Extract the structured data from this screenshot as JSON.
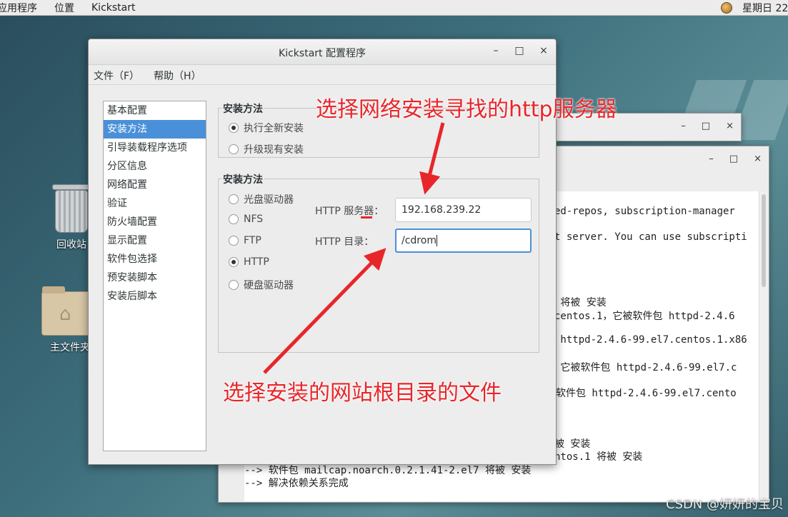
{
  "topbar": {
    "apps": "应用程序",
    "places": "位置",
    "active_app": "Kickstart",
    "clock": "星期日 22"
  },
  "desktop": {
    "trash_label": "回收站",
    "home_label": "主文件夹"
  },
  "terminal": {
    "lines": [
      "ed-repos, subscription-manager",
      "t server. You can use subscripti",
      " 将被 安装",
      "centos.1，它被软件包 httpd-2.4.6",
      " httpd-2.4.6-99.el7.centos.1.x86",
      " 它被软件包 httpd-2.4.6-99.el7.c",
      "它软件包 httpd-2.4.6-99.el7.cento",
      "被 安装",
      "ntos.1 将被 安装",
      "--> 软件包 mailcap.noarch.0.2.1.41-2.el7 将被 安装",
      "--> 解决依赖关系完成"
    ]
  },
  "dialog": {
    "title": "Kickstart 配置程序",
    "minimize": "–",
    "maximize": "□",
    "close": "×",
    "menu": {
      "file": "文件（F）",
      "help": "帮助（H）"
    },
    "sidebar": [
      {
        "label": "基本配置",
        "selected": false
      },
      {
        "label": "安装方法",
        "selected": true
      },
      {
        "label": "引导装载程序选项",
        "selected": false
      },
      {
        "label": "分区信息",
        "selected": false
      },
      {
        "label": "网络配置",
        "selected": false
      },
      {
        "label": "验证",
        "selected": false
      },
      {
        "label": "防火墙配置",
        "selected": false
      },
      {
        "label": "显示配置",
        "selected": false
      },
      {
        "label": "软件包选择",
        "selected": false
      },
      {
        "label": "预安装脚本",
        "selected": false
      },
      {
        "label": "安装后脚本",
        "selected": false
      }
    ],
    "install_group": {
      "legend": "安装方法",
      "options": [
        {
          "label": "执行全新安装",
          "checked": true
        },
        {
          "label": "升级现有安装",
          "checked": false
        }
      ]
    },
    "source_group": {
      "legend": "安装方法",
      "options": [
        {
          "label": "光盘驱动器",
          "checked": false
        },
        {
          "label": "NFS",
          "checked": false
        },
        {
          "label": "FTP",
          "checked": false
        },
        {
          "label": "HTTP",
          "checked": true
        },
        {
          "label": "硬盘驱动器",
          "checked": false
        }
      ],
      "http_server_label": "HTTP 服务器：",
      "http_server_value": "192.168.239.22",
      "http_dir_label": "HTTP 目录：",
      "http_dir_value": "/cdrom"
    }
  },
  "annotations": {
    "top": "选择网络安装寻找的http服务器",
    "bottom": "选择安装的网站根目录的文件",
    "color": "#e8262a"
  },
  "watermark": "CSDN @妍妍的宝贝"
}
